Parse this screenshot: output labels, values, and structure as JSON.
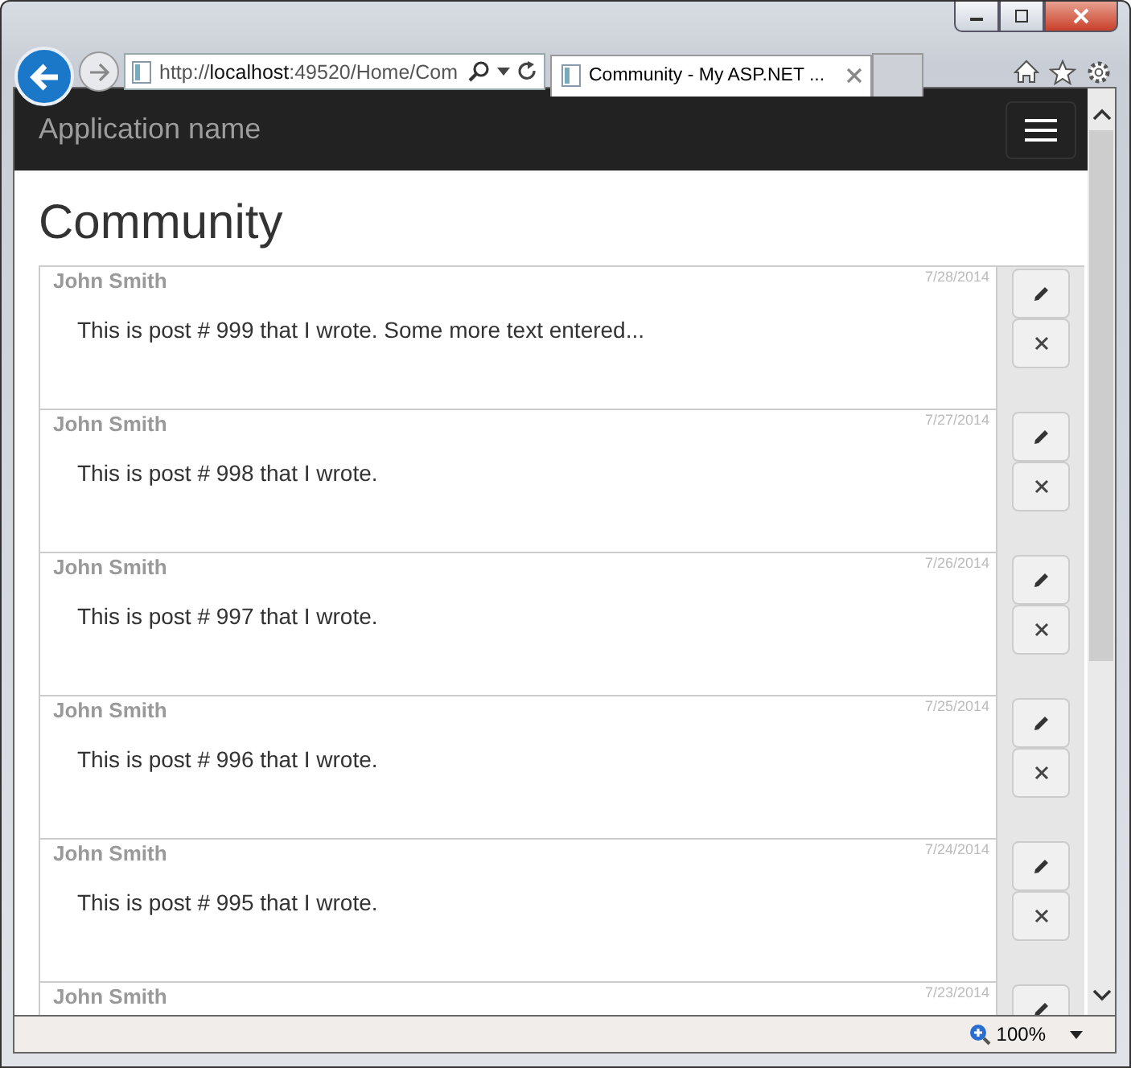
{
  "browser": {
    "address": "http://**localhost**:49520/Home/Com",
    "tab": {
      "title": "Community - My ASP.NET ..."
    }
  },
  "navbar": {
    "brand": "Application name"
  },
  "page": {
    "heading": "Community"
  },
  "posts": [
    {
      "author": "John Smith",
      "date": "7/28/2014",
      "text": "This is post # 999 that I wrote. Some more text entered..."
    },
    {
      "author": "John Smith",
      "date": "7/27/2014",
      "text": "This is post # 998 that I wrote."
    },
    {
      "author": "John Smith",
      "date": "7/26/2014",
      "text": "This is post # 997 that I wrote."
    },
    {
      "author": "John Smith",
      "date": "7/25/2014",
      "text": "This is post # 996 that I wrote."
    },
    {
      "author": "John Smith",
      "date": "7/24/2014",
      "text": "This is post # 995 that I wrote."
    },
    {
      "author": "John Smith",
      "date": "7/23/2014"
    }
  ],
  "status_bar": {
    "zoom": "100%"
  }
}
